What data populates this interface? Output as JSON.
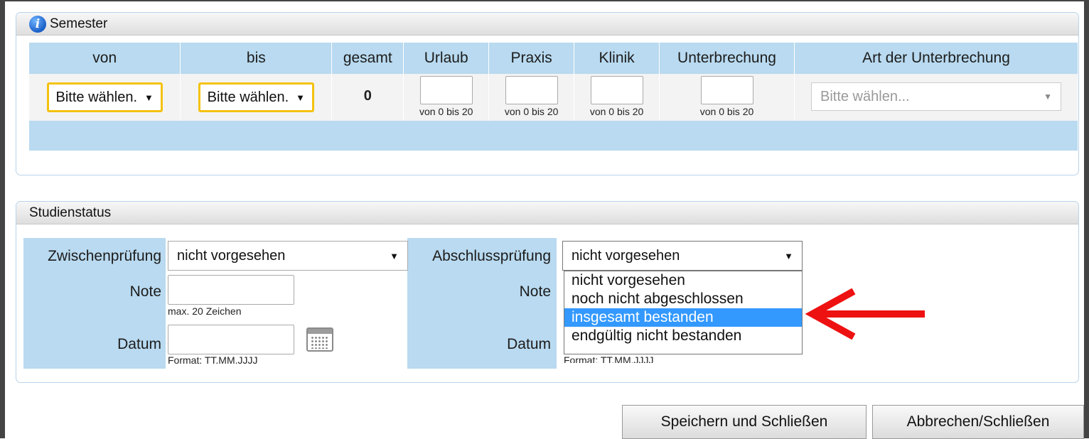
{
  "semester": {
    "title": "Semester",
    "headers": [
      "von",
      "bis",
      "gesamt",
      "Urlaub",
      "Praxis",
      "Klinik",
      "Unterbrechung",
      "Art der Unterbrechung"
    ],
    "von_select": "Bitte wählen.",
    "bis_select": "Bitte wählen.",
    "gesamt_value": "0",
    "range_hint": "von 0 bis 20",
    "art_placeholder": "Bitte wählen..."
  },
  "status": {
    "title": "Studienstatus",
    "zwischen_label": "Zwischenprüfung",
    "zwischen_value": "nicht vorgesehen",
    "abschluss_label": "Abschlussprüfung",
    "abschluss_value": "nicht vorgesehen",
    "note_label": "Note",
    "note_hint": "max. 20 Zeichen",
    "datum_label": "Datum",
    "datum_hint": "Format: TT.MM.JJJJ",
    "datum_hint_partial": "Format: TT.MM.JJJJ",
    "dropdown_options": [
      "nicht vorgesehen",
      "noch nicht abgeschlossen",
      "insgesamt bestanden",
      "endgültig nicht bestanden"
    ],
    "dropdown_selected": "insgesamt bestanden"
  },
  "buttons": {
    "save": "Speichern und Schließen",
    "cancel": "Abbrechen/Schließen"
  },
  "colors": {
    "header_blue": "#b9daf0",
    "highlight": "#3399ff",
    "annotation_arrow": "#ee1111",
    "select_outline": "#f4c20d"
  }
}
